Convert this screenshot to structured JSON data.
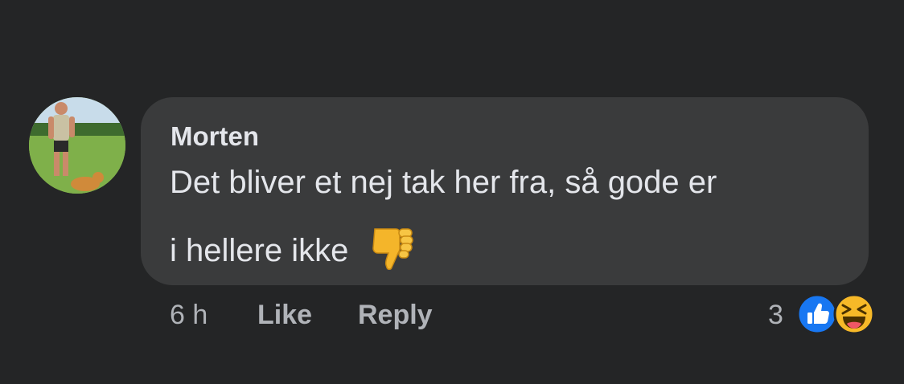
{
  "comment": {
    "author": "Morten",
    "text_line1": "Det bliver et nej tak her fra, så gode er",
    "text_line2": "i hellere ikke",
    "emoji": "thumbs-down-icon"
  },
  "actions": {
    "time": "6 h",
    "like_label": "Like",
    "reply_label": "Reply"
  },
  "reactions": {
    "count": "3",
    "types": [
      "like-reaction-icon",
      "haha-reaction-icon"
    ]
  },
  "colors": {
    "background": "#242526",
    "bubble": "#3a3b3c",
    "text": "#e4e6eb",
    "secondary_text": "#b0b3b8",
    "like_blue": "#1877f2",
    "haha_yellow": "#f7b928"
  }
}
